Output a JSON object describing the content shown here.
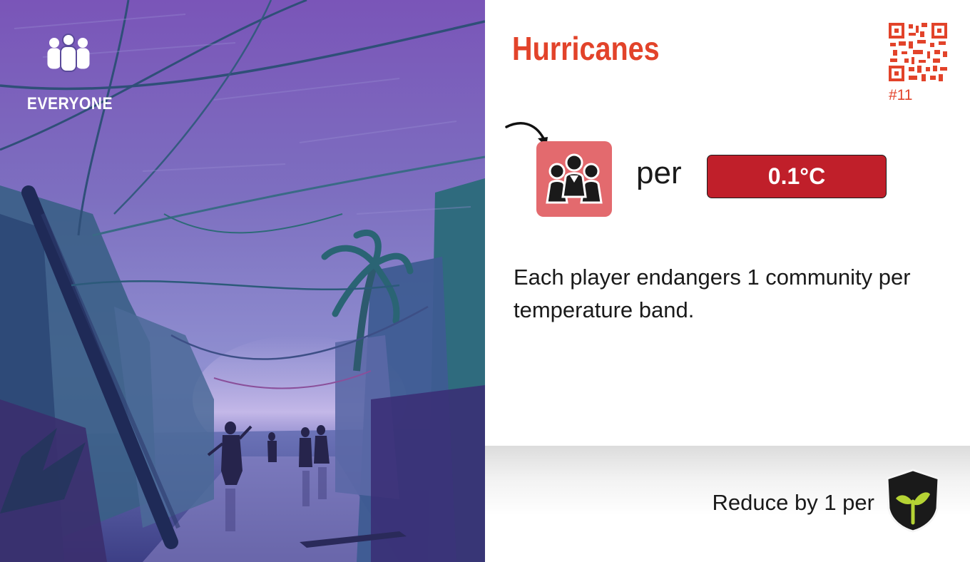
{
  "card": {
    "audience_label": "EVERYONE",
    "audience_icon": "group-people-icon",
    "title": "Hurricanes",
    "card_number": "#11",
    "effect": {
      "icon": "community-icon",
      "per_label": "per",
      "temperature_step": "0.1°C"
    },
    "description": "Each player endangers 1 community per temperature band.",
    "footer": {
      "reduce_label": "Reduce by 1 per",
      "icon": "sprout-shield-icon"
    },
    "colors": {
      "title": "#e2432a",
      "community_tile": "#e36a6e",
      "temperature_badge": "#c01f2a",
      "shield": "#1a1a1a",
      "sprout": "#b5d334",
      "art_sky": "#7d6bb5"
    }
  }
}
